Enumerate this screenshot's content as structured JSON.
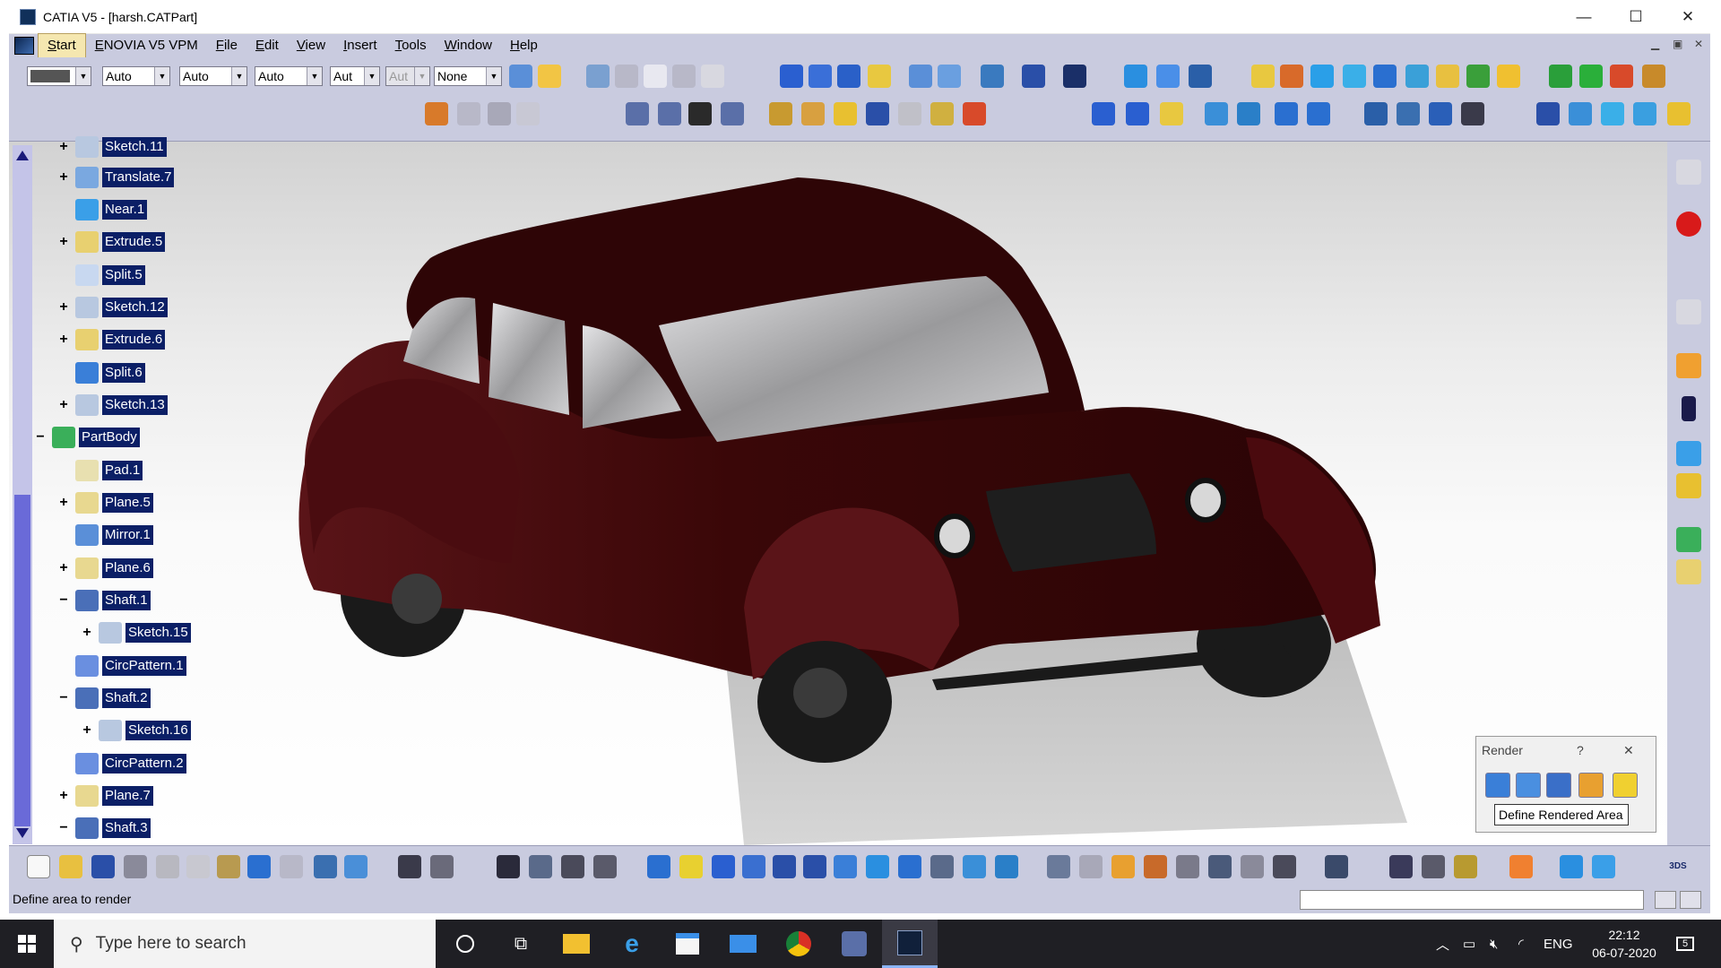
{
  "window": {
    "title": "CATIA V5 - [harsh.CATPart]",
    "minimize_glyph": "—",
    "maximize_glyph": "☐",
    "close_glyph": "✕"
  },
  "menu": [
    "Start",
    "ENOVIA V5 VPM",
    "File",
    "Edit",
    "View",
    "Insert",
    "Tools",
    "Window",
    "Help"
  ],
  "graphic_properties": {
    "color": "",
    "transparency": "Auto",
    "line_thickness": "Auto",
    "linetype": "Auto",
    "point_symbol": "Aut",
    "render_style": "Aut",
    "layer": "None"
  },
  "tree": [
    {
      "label": "Sketch.11",
      "expander": "+"
    },
    {
      "label": "Translate.7",
      "expander": "+"
    },
    {
      "label": "Near.1",
      "expander": ""
    },
    {
      "label": "Extrude.5",
      "expander": "+"
    },
    {
      "label": "Split.5",
      "expander": ""
    },
    {
      "label": "Sketch.12",
      "expander": "+"
    },
    {
      "label": "Extrude.6",
      "expander": "+"
    },
    {
      "label": "Split.6",
      "expander": ""
    },
    {
      "label": "Sketch.13",
      "expander": "+"
    },
    {
      "label": "PartBody",
      "expander": "−"
    },
    {
      "label": "Pad.1",
      "expander": ""
    },
    {
      "label": "Plane.5",
      "expander": "+"
    },
    {
      "label": "Mirror.1",
      "expander": ""
    },
    {
      "label": "Plane.6",
      "expander": "+"
    },
    {
      "label": "Shaft.1",
      "expander": "−"
    },
    {
      "label": "Sketch.15",
      "expander": "+"
    },
    {
      "label": "CircPattern.1",
      "expander": ""
    },
    {
      "label": "Shaft.2",
      "expander": "−"
    },
    {
      "label": "Sketch.16",
      "expander": "+"
    },
    {
      "label": "CircPattern.2",
      "expander": ""
    },
    {
      "label": "Plane.7",
      "expander": "+"
    },
    {
      "label": "Shaft.3",
      "expander": "−"
    }
  ],
  "render_panel": {
    "title": "Render",
    "help": "?",
    "close": "✕",
    "tooltip": "Define Rendered Area"
  },
  "status": {
    "message": "Define area to render"
  },
  "taskbar": {
    "search_placeholder": "Type here to search",
    "language": "ENG",
    "time": "22:12",
    "date": "06-07-2020",
    "notifications": "5"
  },
  "colors": {
    "tree_label_bg": "#0b1f66",
    "toolbar_bg": "#c9cbdf",
    "car_body": "#3a0708",
    "taskbar_bg": "#1f1f24"
  }
}
